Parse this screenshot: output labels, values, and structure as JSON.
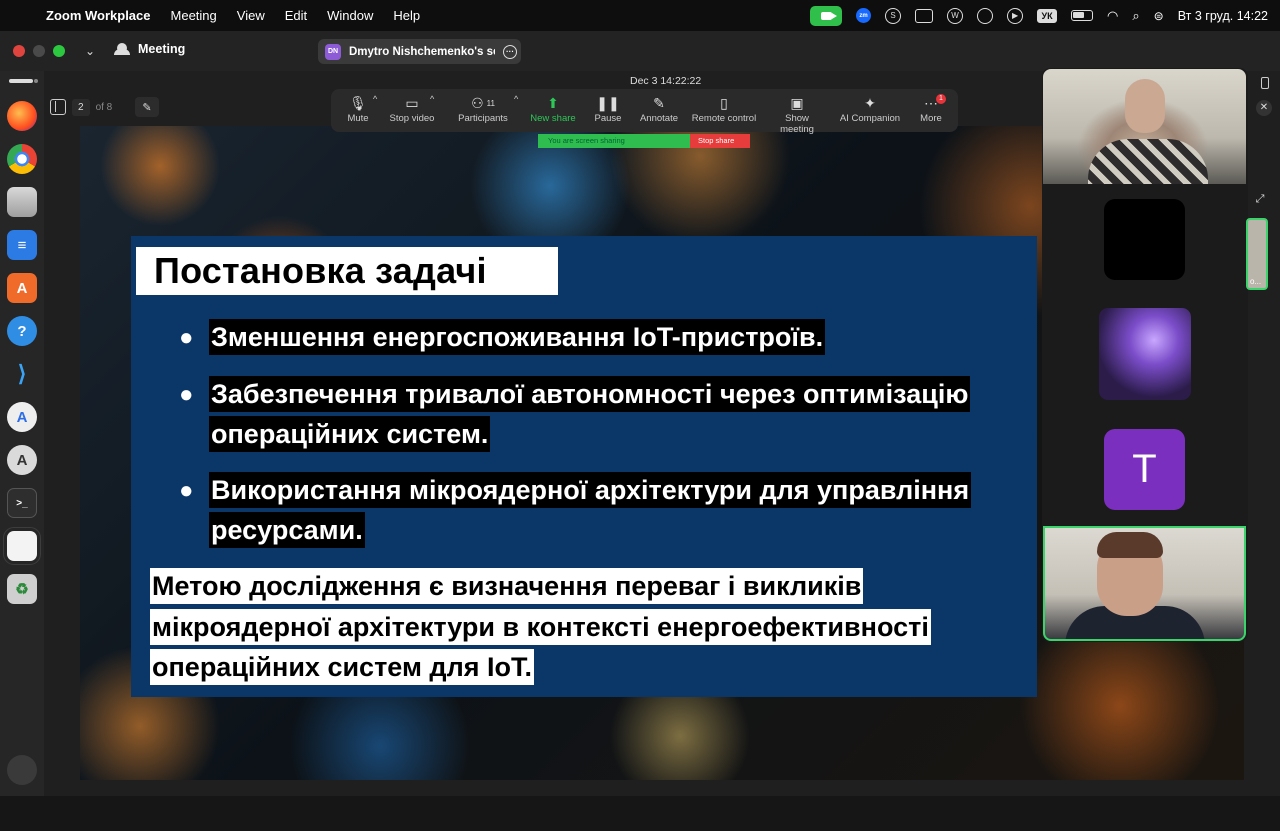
{
  "menubar": {
    "app_name": "Zoom Workplace",
    "items": [
      "Meeting",
      "View",
      "Edit",
      "Window",
      "Help"
    ],
    "lang": "УК",
    "datetime": "Вт 3 груд.  14:22"
  },
  "window": {
    "meeting_label": "Meeting",
    "share_tab_initials": "DN",
    "share_tab_label": "Dmytro Nishchemenko's scre"
  },
  "viewer": {
    "timestamp": "Dec 3  14:22:22",
    "page_current": "2",
    "page_total": "of 8"
  },
  "toolbar": {
    "items": [
      {
        "label": "Mute"
      },
      {
        "label": "Stop video"
      },
      {
        "label": "Participants",
        "count": "11"
      },
      {
        "label": "New share"
      },
      {
        "label": "Pause"
      },
      {
        "label": "Annotate"
      },
      {
        "label": "Remote control"
      },
      {
        "label": "Show meeting"
      },
      {
        "label": "AI Companion"
      },
      {
        "label": "More",
        "badge": "1"
      }
    ],
    "sharing_text": "You are screen sharing",
    "stop_share": "Stop share"
  },
  "slide": {
    "title": "Постановка задачі",
    "bullets": [
      [
        "Зменшення енергоспоживання IoT-пристроїв."
      ],
      [
        "Забезпечення тривалої автономності через оптимізацію",
        "операційних систем."
      ],
      [
        "Використання мікроядерної архітектури для управління",
        "ресурсами."
      ]
    ],
    "goal_lines": [
      "Метою дослідження є визначення переваг і викликів",
      "мікроядерної архітектури в контексті енергоефективності",
      "операційних систем для IoT."
    ]
  },
  "participants": {
    "tile_letter": "T",
    "thumb_label": "o..."
  },
  "colors": {
    "slide_panel": "#0b3768",
    "zoom_green": "#2fbd4f",
    "stop_red": "#e73c3c",
    "avatar_purple": "#7b2fbe"
  }
}
